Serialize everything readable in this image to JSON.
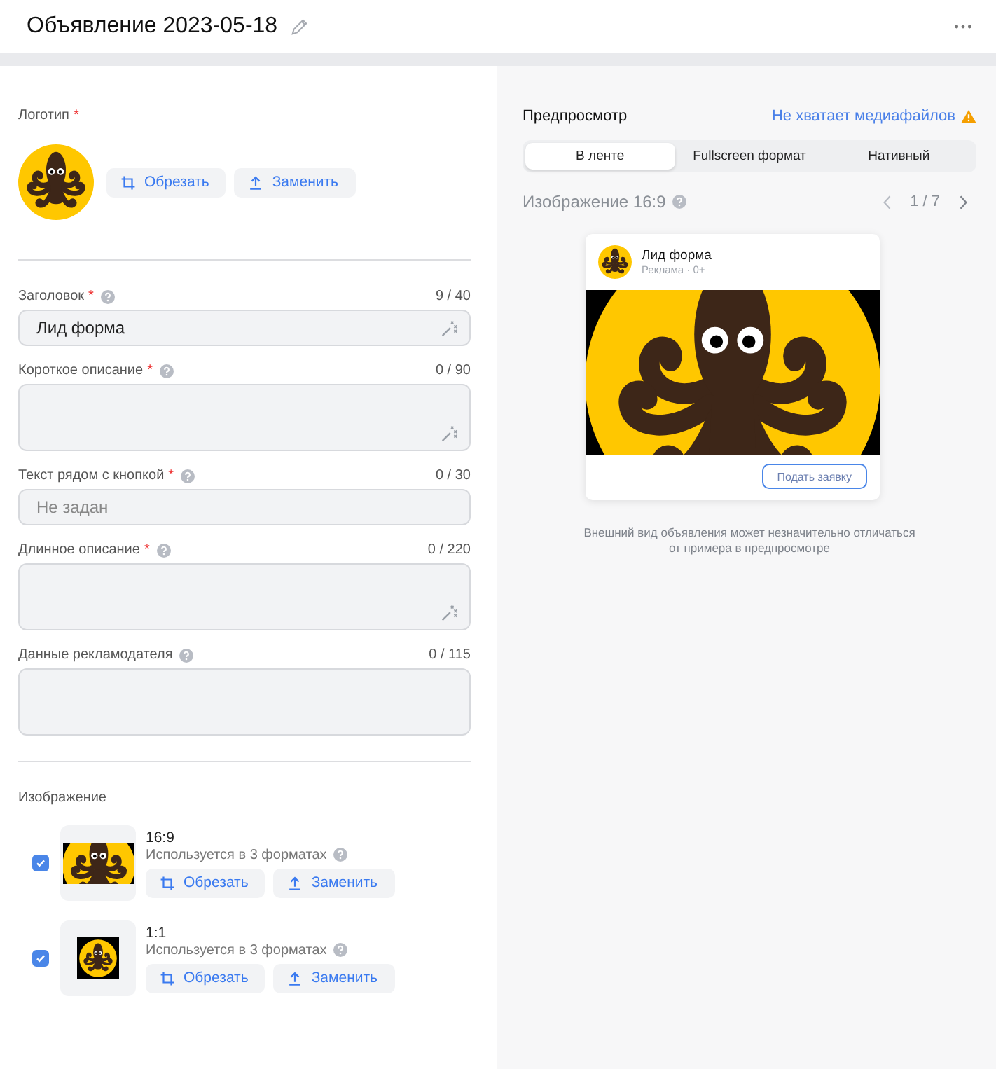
{
  "title": "Объявление 2023-05-18",
  "logo": {
    "label": "Логотип",
    "required_mark": "*",
    "buttons": [
      {
        "kind": "crop",
        "label": "Обрезать"
      },
      {
        "kind": "upload",
        "label": "Заменить"
      }
    ]
  },
  "fields": [
    {
      "label": "Заголовок",
      "required_mark": "*",
      "counter": "9 / 40",
      "kind": "input",
      "value": "Лид форма",
      "ai_assist": true
    },
    {
      "label": "Короткое описание",
      "required_mark": "*",
      "counter": "0 / 90",
      "kind": "textarea",
      "ai_assist": true
    },
    {
      "label": "Текст рядом с кнопкой",
      "required_mark": "*",
      "counter": "0 / 30",
      "kind": "input",
      "placeholder": "Не задан",
      "ai_assist": false
    },
    {
      "label": "Длинное описание",
      "required_mark": "*",
      "counter": "0 / 220",
      "kind": "textarea",
      "ai_assist": true
    },
    {
      "label": "Данные рекламодателя",
      "counter": "0 / 115",
      "kind": "textarea",
      "ai_assist": false
    }
  ],
  "images": {
    "label": "Изображение",
    "items": [
      {
        "kind": "wide",
        "ratio": "16:9",
        "note": "Используется в 3 форматах",
        "checked": true,
        "buttons": [
          {
            "kind": "crop",
            "label": "Обрезать"
          },
          {
            "kind": "upload",
            "label": "Заменить"
          }
        ]
      },
      {
        "kind": "square",
        "ratio": "1:1",
        "note": "Используется в 3 форматах",
        "checked": true,
        "buttons": [
          {
            "kind": "crop",
            "label": "Обрезать"
          },
          {
            "kind": "upload",
            "label": "Заменить"
          }
        ]
      }
    ]
  },
  "preview": {
    "title": "Предпросмотр",
    "warning": "Не хватает медиафайлов",
    "tabs": [
      {
        "label": "В ленте",
        "selected": true
      },
      {
        "label": "Fullscreen формат",
        "selected": false
      },
      {
        "label": "Нативный",
        "selected": false
      }
    ],
    "format": "Изображение 16:9",
    "pager": "1 / 7",
    "card": {
      "name": "Лид форма",
      "meta": "Реклама · 0+",
      "cta": "Подать заявку"
    },
    "note": "Внешний вид объявления может незначительно отличаться от примера в предпросмотре"
  }
}
